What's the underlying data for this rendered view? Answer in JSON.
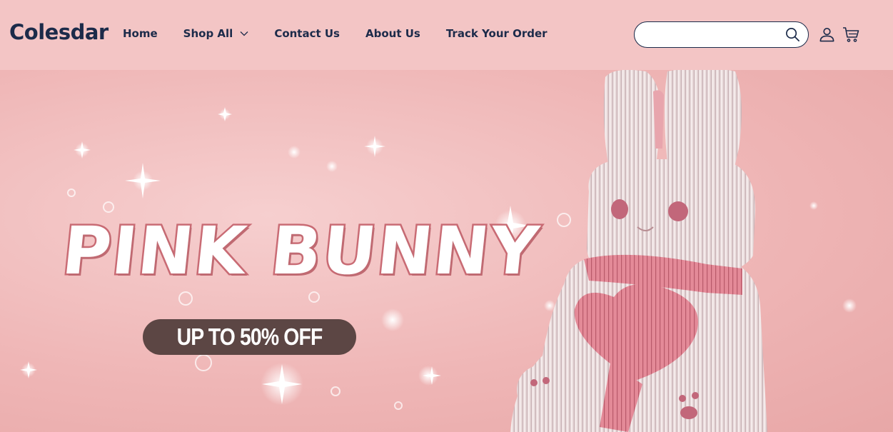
{
  "header": {
    "logo": "Colesdar",
    "nav": [
      {
        "label": "Home",
        "has_dropdown": false
      },
      {
        "label": "Shop All",
        "has_dropdown": true
      },
      {
        "label": "Contact Us",
        "has_dropdown": false
      },
      {
        "label": "About Us",
        "has_dropdown": false
      },
      {
        "label": "Track Your Order",
        "has_dropdown": false
      }
    ],
    "search": {
      "value": "",
      "placeholder": "",
      "icon": "search-icon"
    },
    "icons": [
      "account-icon",
      "cart-icon"
    ]
  },
  "hero": {
    "title": "PINK BUNNY",
    "promo": "UP TO 50% OFF",
    "image": "white ribbed bunny sculpture holding a pink heart"
  },
  "colors": {
    "header_bg": "#f3c5c5",
    "nav_text": "#1c2b4a",
    "hero_bg": "#efb6b6",
    "title_stroke": "#c96b74",
    "promo_bg": "#5c4644"
  }
}
